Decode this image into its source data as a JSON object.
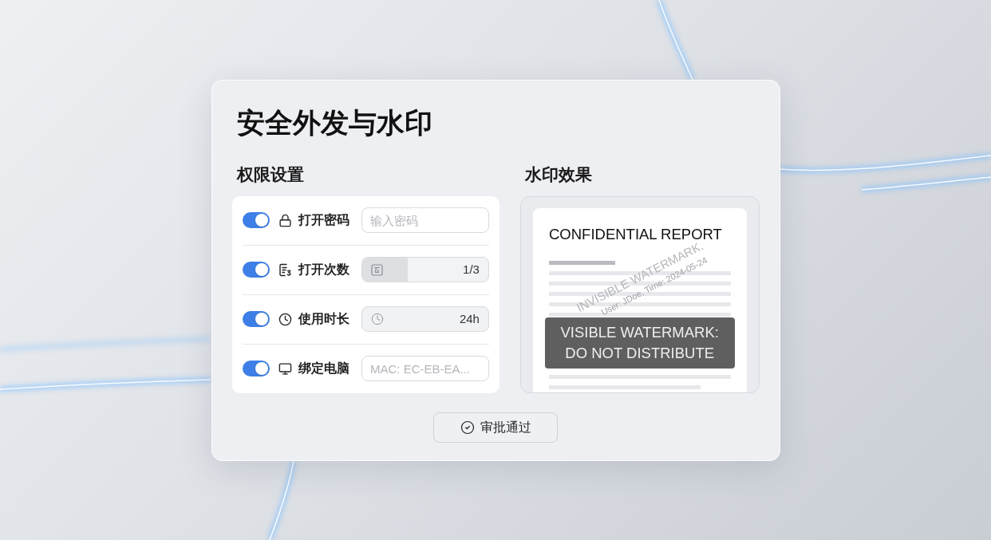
{
  "dialog": {
    "title": "安全外发与水印",
    "permissions": {
      "heading": "权限设置",
      "rows": [
        {
          "kind": "password",
          "label": "打开密码",
          "on": true,
          "placeholder": "输入密码"
        },
        {
          "kind": "counter",
          "label": "打开次数",
          "on": true,
          "value": "1/3",
          "level": 0.36
        },
        {
          "kind": "duration",
          "label": "使用时长",
          "on": true,
          "value": "24h"
        },
        {
          "kind": "device",
          "label": "绑定电脑",
          "on": true,
          "placeholder": "MAC: EC-EB-EA..."
        }
      ]
    },
    "preview": {
      "heading": "水印效果",
      "document": {
        "title": "CONFIDENTIAL REPORT",
        "invisible_watermark": "INVISIBLE WATERMARK.",
        "invisible_watermark_detail": "User: JDoe, Time: 2024-05-24",
        "visible_watermark": [
          "VISIBLE WATERMARK:",
          "DO NOT DISTRIBUTE"
        ]
      }
    },
    "approve_button": {
      "label": "审批通过"
    }
  }
}
